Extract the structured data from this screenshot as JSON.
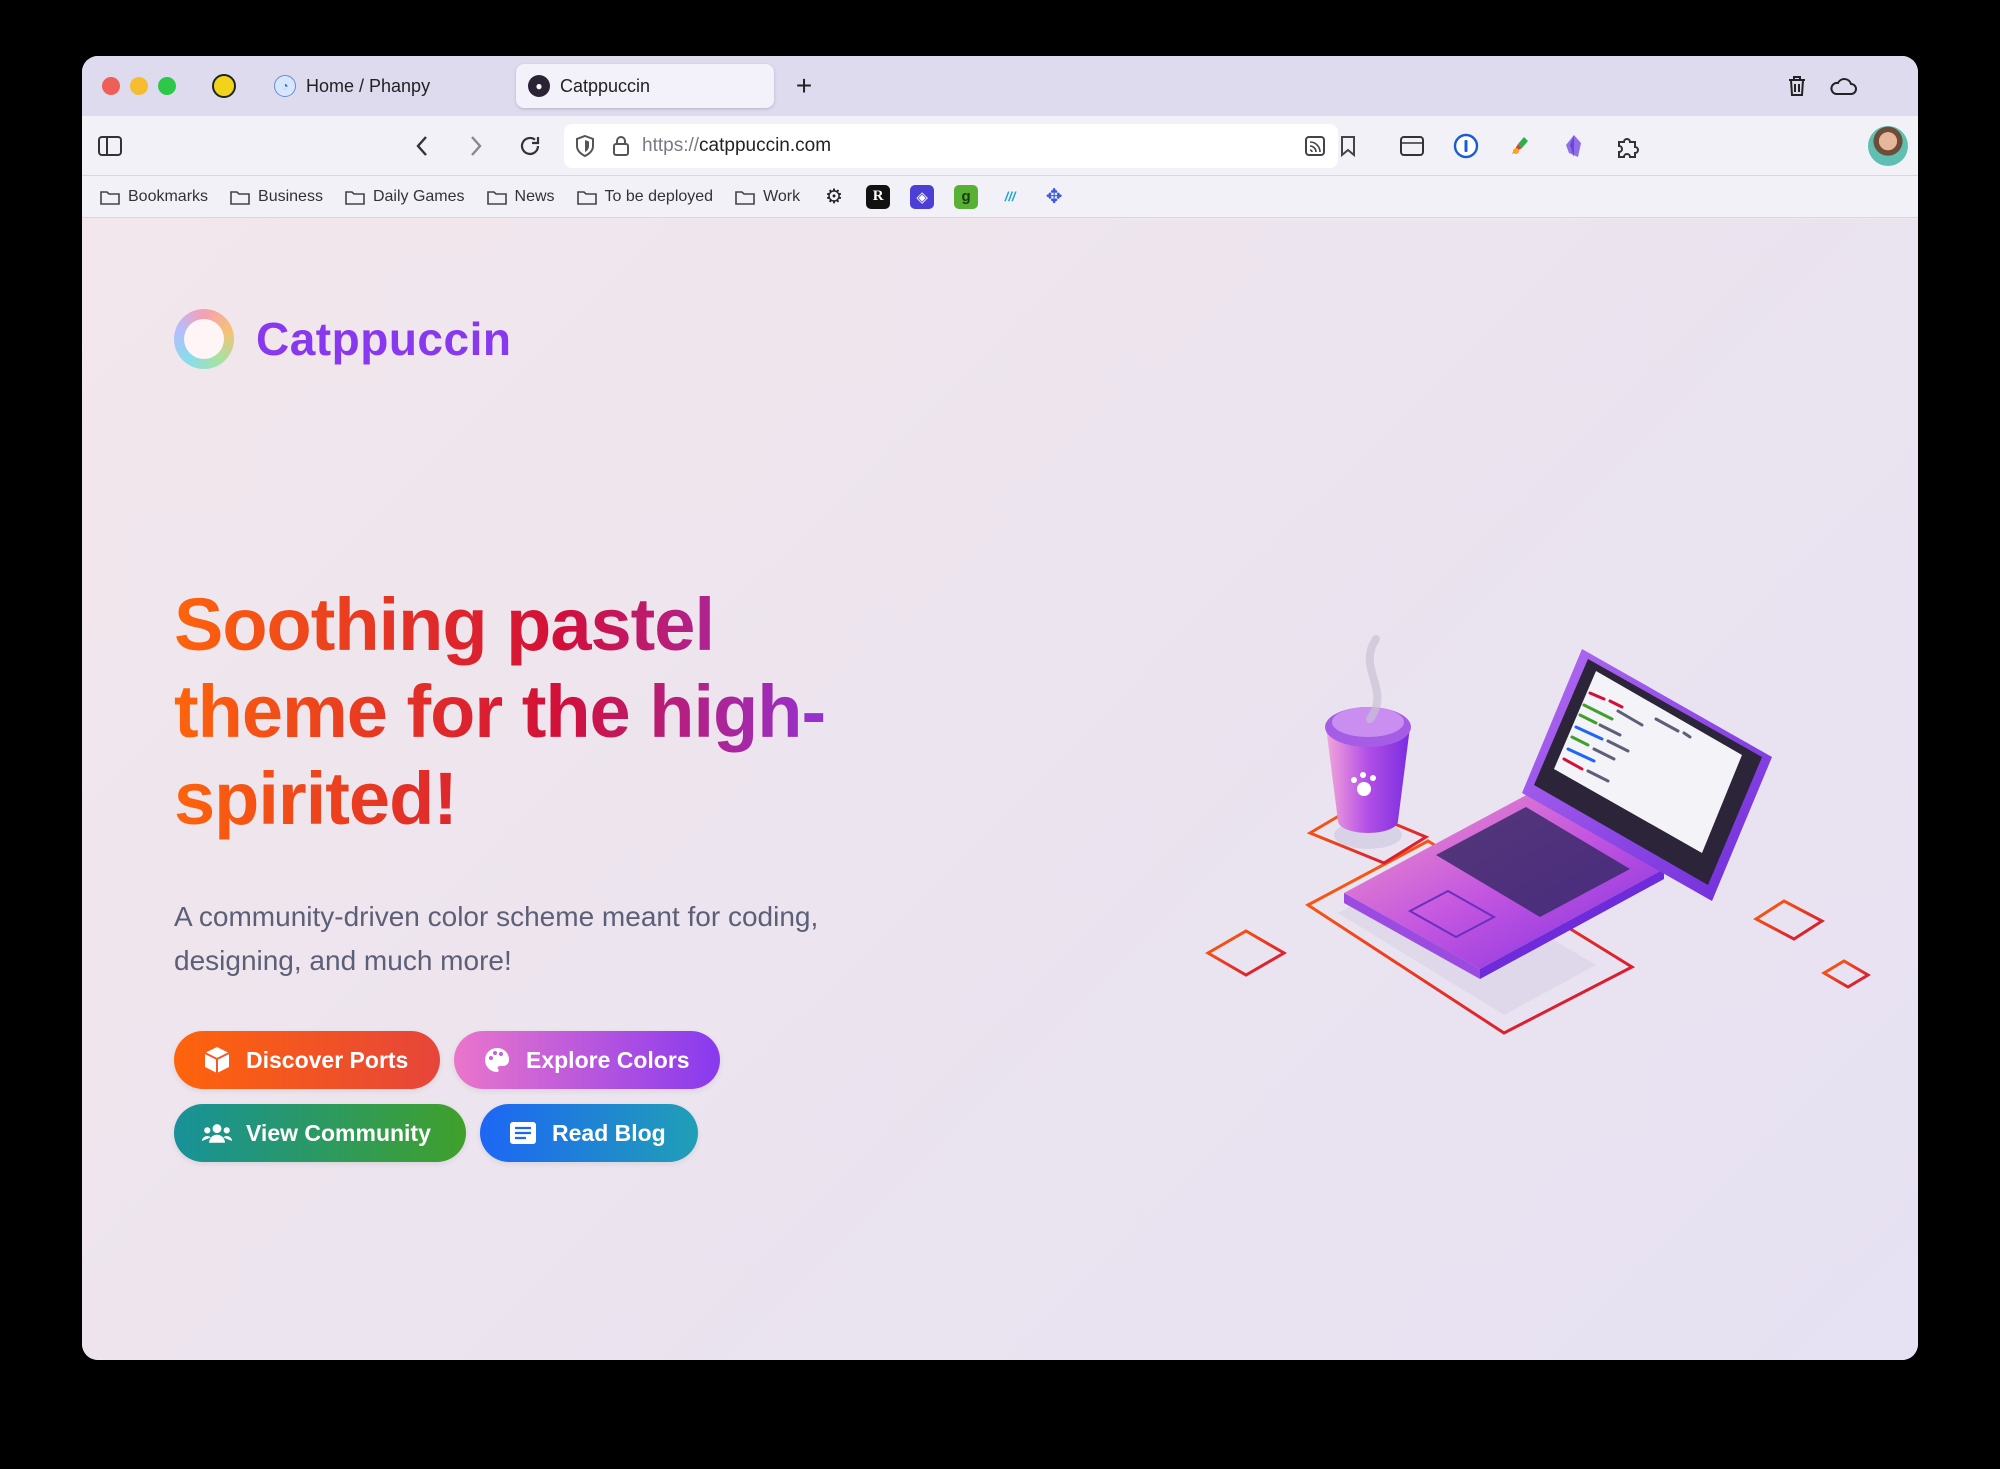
{
  "browser": {
    "tabs": [
      {
        "label": "Home / Phanpy",
        "active": false
      },
      {
        "label": "Catppuccin",
        "active": true
      }
    ],
    "new_tab_label": "+",
    "url": {
      "scheme": "https://",
      "host": "catppuccin.com"
    },
    "bookmarks": [
      {
        "label": "Bookmarks",
        "icon": "folder-icon"
      },
      {
        "label": "Business",
        "icon": "folder-icon"
      },
      {
        "label": "Daily Games",
        "icon": "folder-icon"
      },
      {
        "label": "News",
        "icon": "folder-icon"
      },
      {
        "label": "To be deployed",
        "icon": "folder-icon"
      },
      {
        "label": "Work",
        "icon": "folder-icon"
      }
    ],
    "favicons": [
      {
        "name": "openai-icon",
        "glyph": "⚙"
      },
      {
        "name": "r-icon",
        "glyph": "R"
      },
      {
        "name": "bluesky-like-icon",
        "glyph": "◈"
      },
      {
        "name": "g-icon",
        "glyph": "g"
      },
      {
        "name": "stripes-icon",
        "glyph": "///"
      },
      {
        "name": "tree-icon",
        "glyph": "✥"
      }
    ]
  },
  "site": {
    "brand_name": "Catppuccin",
    "headline": "Soothing pastel theme for the high-spirited!",
    "subtitle": "A community-driven color scheme meant for coding, designing, and much more!",
    "buttons": {
      "ports": "Discover Ports",
      "colors": "Explore Colors",
      "community": "View Community",
      "blog": "Read Blog"
    }
  },
  "colors": {
    "mauve": "#8839ef",
    "peach": "#fe640b",
    "red": "#d20f39",
    "pink": "#ea76cb",
    "teal": "#179299",
    "green": "#40a02b",
    "blue": "#1e66f5",
    "text_muted": "#5c5f77"
  }
}
